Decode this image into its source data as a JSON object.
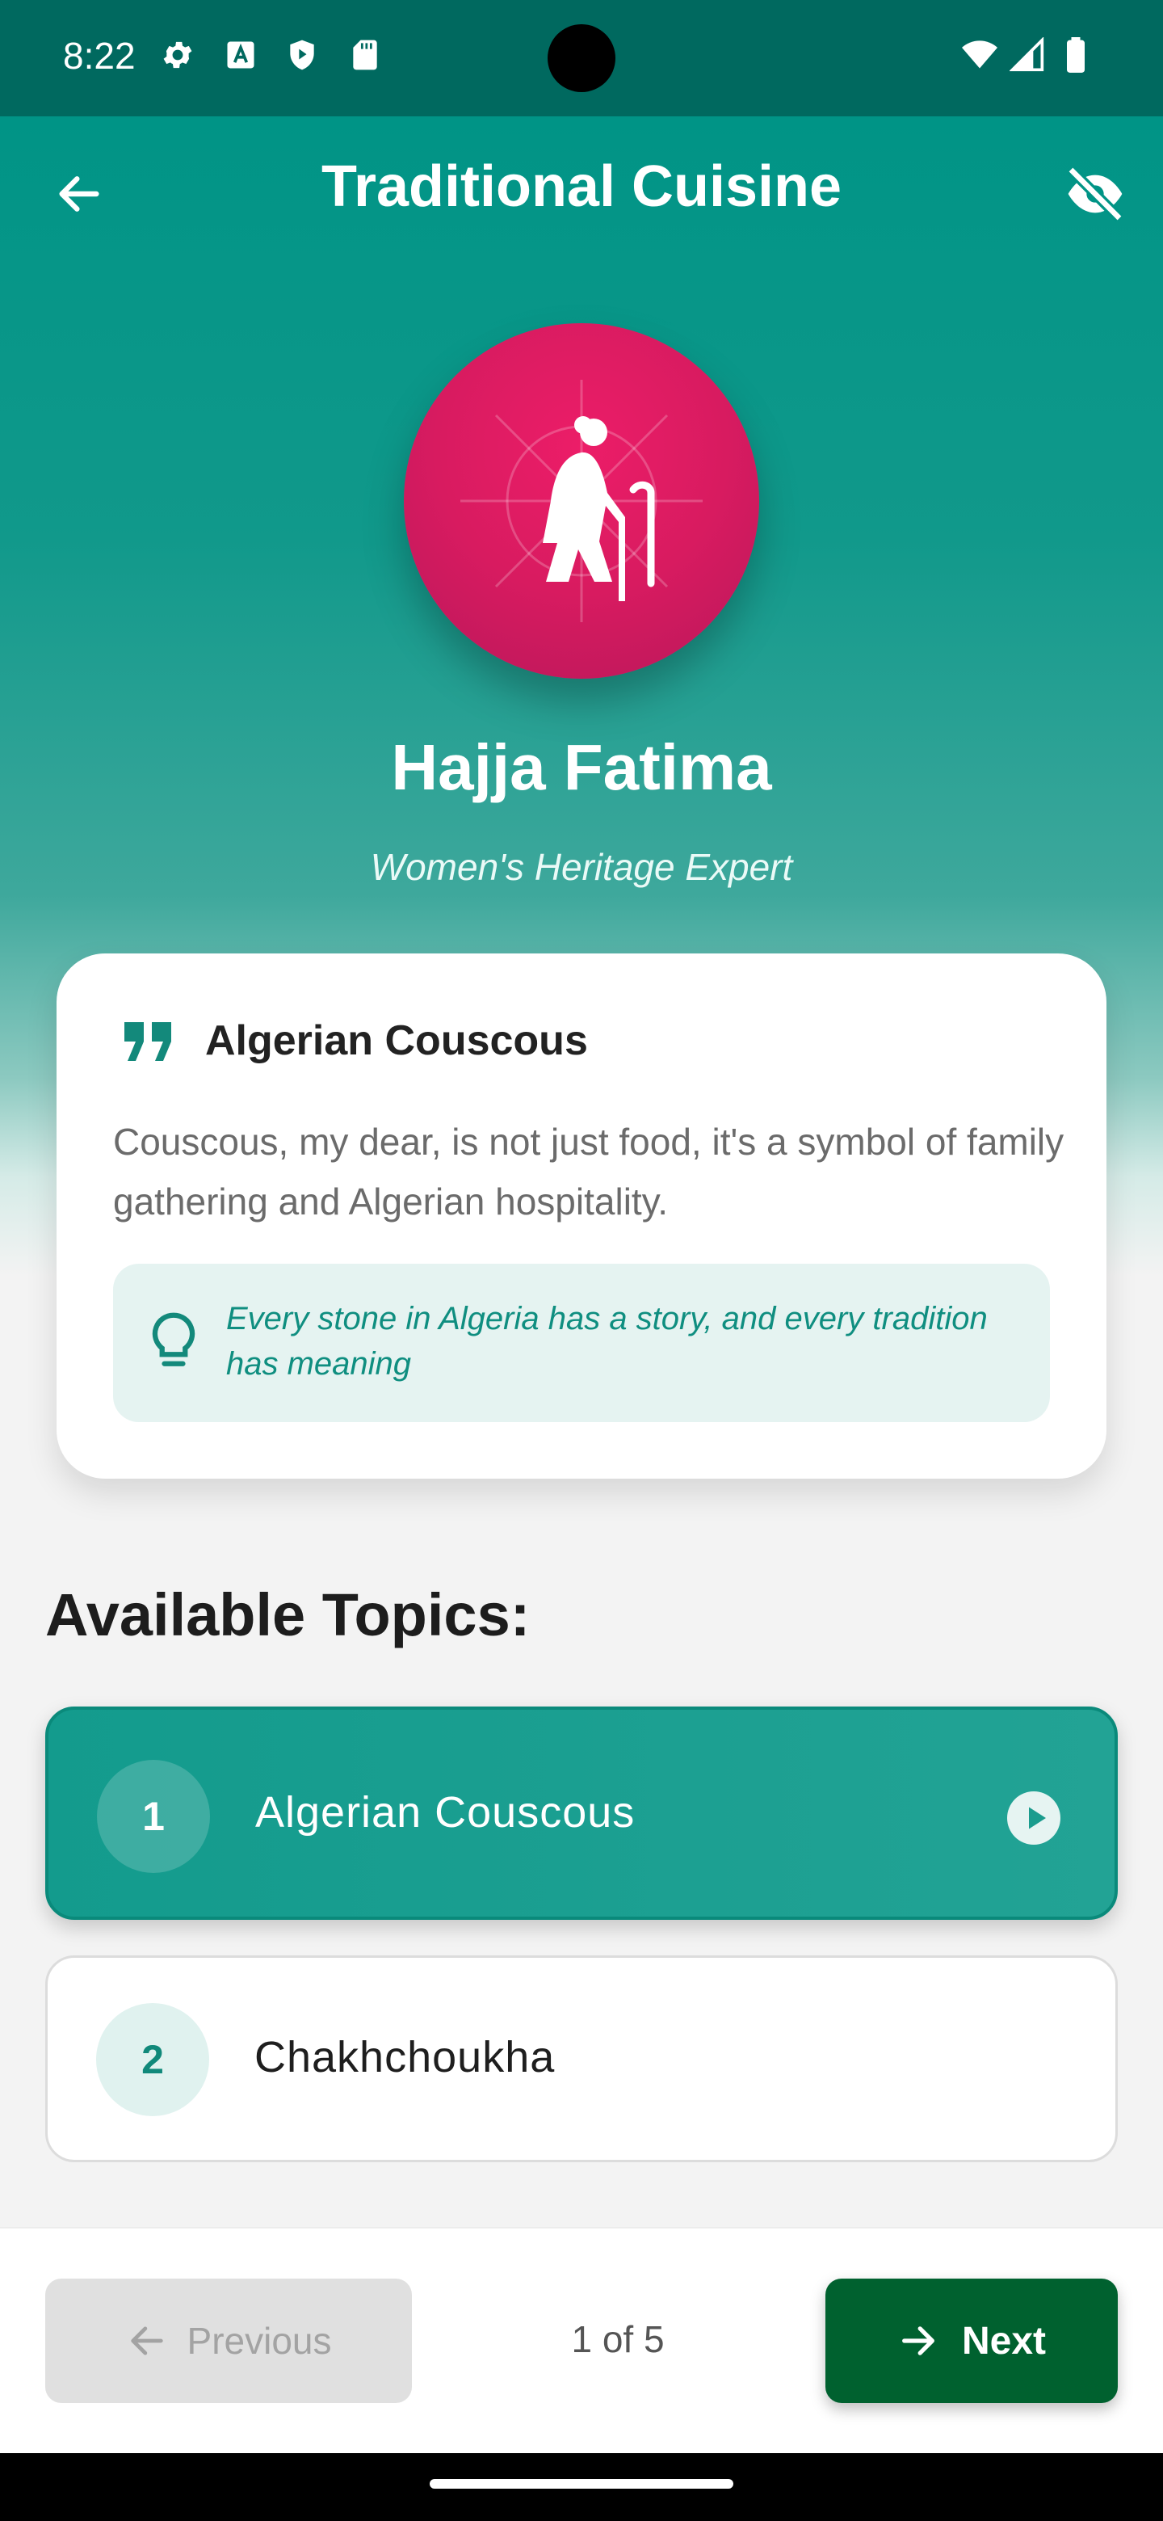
{
  "status_bar": {
    "time": "8:22"
  },
  "app_bar": {
    "title": "Traditional Cuisine"
  },
  "expert": {
    "name": "Hajja Fatima",
    "role": "Women's Heritage Expert"
  },
  "quote": {
    "title": "Algerian Couscous",
    "text": "Couscous, my dear, is not just food, it's a symbol of family gathering and Algerian hospitality.",
    "tip": "Every stone in Algeria has a story, and every tradition has meaning"
  },
  "topics": {
    "heading": "Available Topics:",
    "items": [
      {
        "number": "1",
        "label": "Algerian Couscous",
        "active": true
      },
      {
        "number": "2",
        "label": "Chakhchoukha",
        "active": false
      }
    ]
  },
  "navigation": {
    "previous_label": "Previous",
    "page_indicator": "1 of 5",
    "next_label": "Next"
  },
  "colors": {
    "primary": "#009486",
    "avatar": "#d81b60",
    "next_button": "#00612f"
  }
}
